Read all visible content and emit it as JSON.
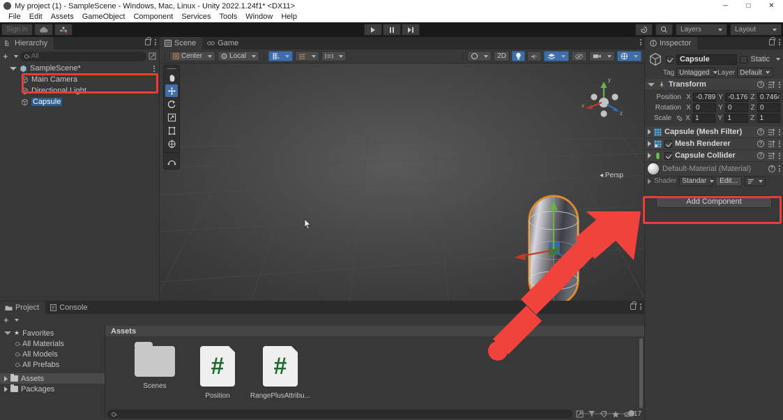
{
  "window": {
    "title": "My project (1) - SampleScene - Windows, Mac, Linux - Unity 2022.1.24f1* <DX11>",
    "minimize": "─",
    "maximize": "□",
    "close": "✕"
  },
  "menubar": [
    "File",
    "Edit",
    "Assets",
    "GameObject",
    "Component",
    "Services",
    "Tools",
    "Window",
    "Help"
  ],
  "toolbar": {
    "signin": "Sign in",
    "cloud_icon": "cloud-icon",
    "collab_icon": "collab-icon",
    "play_icon": "play-icon",
    "pause_icon": "pause-icon",
    "step_icon": "step-icon",
    "history_icon": "history-icon",
    "search_icon": "search-icon",
    "layers": "Layers",
    "layout": "Layout"
  },
  "hierarchy": {
    "tab": "Hierarchy",
    "tab_icon": "hierarchy-icon",
    "add_label": "+",
    "search_placeholder": "All",
    "items": [
      {
        "label": "SampleScene*",
        "depth": 0,
        "icon": "scene-icon",
        "selected": false
      },
      {
        "label": "Main Camera",
        "depth": 1,
        "icon": "gameobject-icon",
        "selected": false
      },
      {
        "label": "Directional Light",
        "depth": 1,
        "icon": "gameobject-icon",
        "selected": false
      },
      {
        "label": "Capsule",
        "depth": 1,
        "icon": "gameobject-icon",
        "selected": true
      }
    ]
  },
  "scene": {
    "tabs": [
      {
        "label": "Scene",
        "icon": "scene-view-icon",
        "active": true
      },
      {
        "label": "Game",
        "icon": "game-view-icon",
        "active": false
      }
    ],
    "pivot_mode": "Center",
    "pivot_rotation": "Local",
    "grid_icon": "grid-snap-icon",
    "snap_icon": "snap-increment-icon",
    "layout_icon": "align-icon",
    "shading_mode_icon": "shaded-icon",
    "two_d_label": "2D",
    "light_icon": "lighting-icon",
    "audio_icon": "audio-icon",
    "fx_icon": "effects-icon",
    "visibility_icon": "scene-visibility-icon",
    "camera_icon": "scene-camera-icon",
    "gizmos_icon": "gizmos-icon",
    "perspective_label": "Persp",
    "axis_labels": {
      "x": "x",
      "y": "y",
      "z": "z"
    },
    "tools": [
      {
        "name": "hand-tool",
        "active": false
      },
      {
        "name": "move-tool",
        "active": true
      },
      {
        "name": "rotate-tool",
        "active": false
      },
      {
        "name": "scale-tool",
        "active": false
      },
      {
        "name": "rect-tool",
        "active": false
      },
      {
        "name": "transform-tool",
        "active": false
      },
      {
        "name": "custom-editor-tool",
        "active": false
      }
    ]
  },
  "inspector": {
    "tab": "Inspector",
    "object_name": "Capsule",
    "enabled": true,
    "static_label": "Static",
    "tag_label": "Tag",
    "tag_value": "Untagged",
    "layer_label": "Layer",
    "layer_value": "Default",
    "transform": {
      "title": "Transform",
      "rows": [
        {
          "label": "Position",
          "x": "-0.789",
          "y": "-0.176",
          "z": "0.7464"
        },
        {
          "label": "Rotation",
          "x": "0",
          "y": "0",
          "z": "0"
        },
        {
          "label": "Scale",
          "x": "1",
          "y": "1",
          "z": "1"
        }
      ]
    },
    "components": [
      {
        "label": "Capsule (Mesh Filter)",
        "icon": "mesh-filter-icon",
        "has_checkbox": false,
        "checked": false
      },
      {
        "label": "Mesh Renderer",
        "icon": "mesh-renderer-icon",
        "has_checkbox": true,
        "checked": true
      },
      {
        "label": "Capsule Collider",
        "icon": "capsule-collider-icon",
        "has_checkbox": true,
        "checked": true
      }
    ],
    "material": {
      "name": "Default-Material (Material)",
      "shader_label": "Shader",
      "shader_value": "Standar",
      "edit_label": "Edit..."
    },
    "add_component": "Add Component"
  },
  "project": {
    "tabs": [
      {
        "label": "Project",
        "icon": "project-icon",
        "active": true
      },
      {
        "label": "Console",
        "icon": "console-icon",
        "active": false
      }
    ],
    "tree": [
      {
        "label": "Favorites",
        "type": "root",
        "icon": "star-icon"
      },
      {
        "label": "All Materials",
        "type": "favorite",
        "icon": "search-icon"
      },
      {
        "label": "All Models",
        "type": "favorite",
        "icon": "search-icon"
      },
      {
        "label": "All Prefabs",
        "type": "favorite",
        "icon": "search-icon"
      },
      {
        "label": "Assets",
        "type": "folder",
        "icon": "folder-icon",
        "selected": true
      },
      {
        "label": "Packages",
        "type": "folder",
        "icon": "folder-icon",
        "selected": false
      }
    ],
    "breadcrumb": "Assets",
    "assets": [
      {
        "label": "Scenes",
        "kind": "folder"
      },
      {
        "label": "Position",
        "kind": "csharp"
      },
      {
        "label": "RangePlusAttribu...",
        "kind": "csharp"
      }
    ],
    "search_placeholder": "",
    "badge_count": "17"
  },
  "annotations": {
    "hierarchy_box": "red-highlight-box",
    "add_component_box": "red-highlight-box",
    "arrow": "red-arrow-annotation",
    "cursor": "mouse-pointer"
  },
  "colors": {
    "accent_blue": "#3f6ea8",
    "annotation_red": "#ef3b36",
    "selection_blue": "#2f5c8f",
    "panel_bg": "#383838",
    "toolbar_bg": "#191919",
    "outline_orange": "#e08a30",
    "csharp_green": "#1f6b2e"
  }
}
